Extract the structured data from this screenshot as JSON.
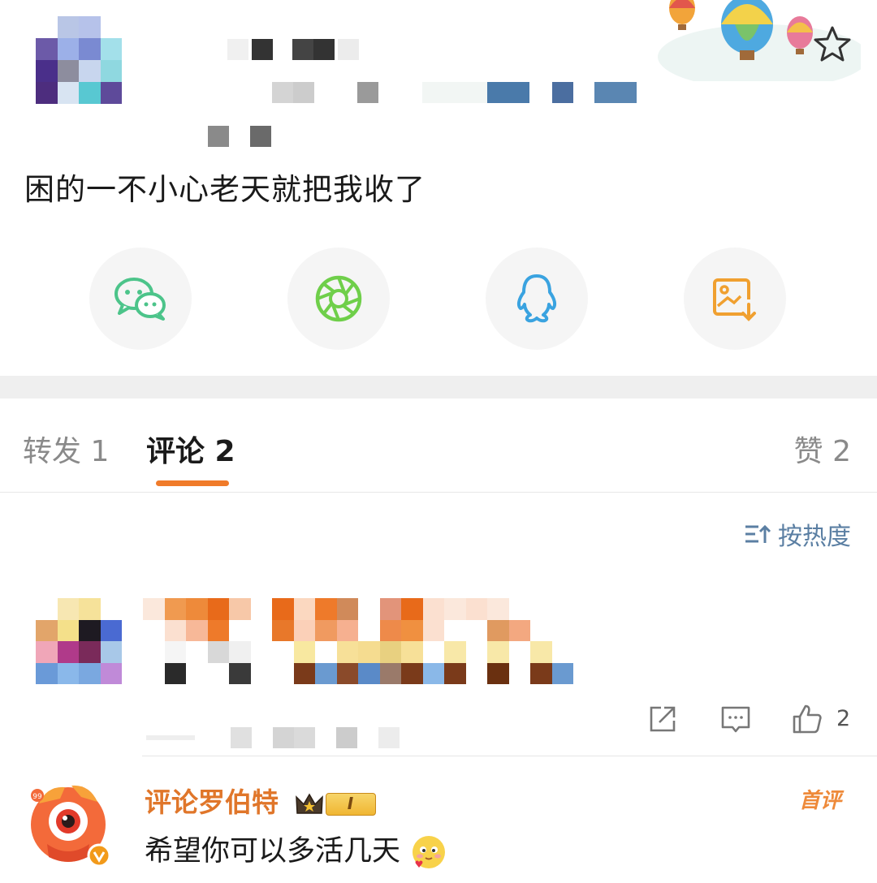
{
  "post": {
    "text": "困的一不小心老天就把我收了"
  },
  "icons": {
    "favorite": "star-outline-icon",
    "share": [
      "wechat-icon",
      "moments-icon",
      "qq-icon",
      "save-image-icon"
    ],
    "comment_actions": [
      "share-icon",
      "comment-icon",
      "thumb-up-icon"
    ]
  },
  "colors": {
    "accent": "#f07b2a",
    "wechat": "#4cc48a",
    "moments": "#6fcf4a",
    "qq": "#3aa3e0",
    "save": "#f0a030",
    "link": "#5b7fa3"
  },
  "tabs": {
    "repost": "转发 1",
    "comment": "评论 2",
    "like": "赞 2"
  },
  "sort_label": "按热度",
  "comment": {
    "like_count": "2"
  },
  "bot_comment": {
    "name": "评论罗伯特",
    "level": "I",
    "text": "希望你可以多活几天",
    "first_badge": "首评"
  }
}
